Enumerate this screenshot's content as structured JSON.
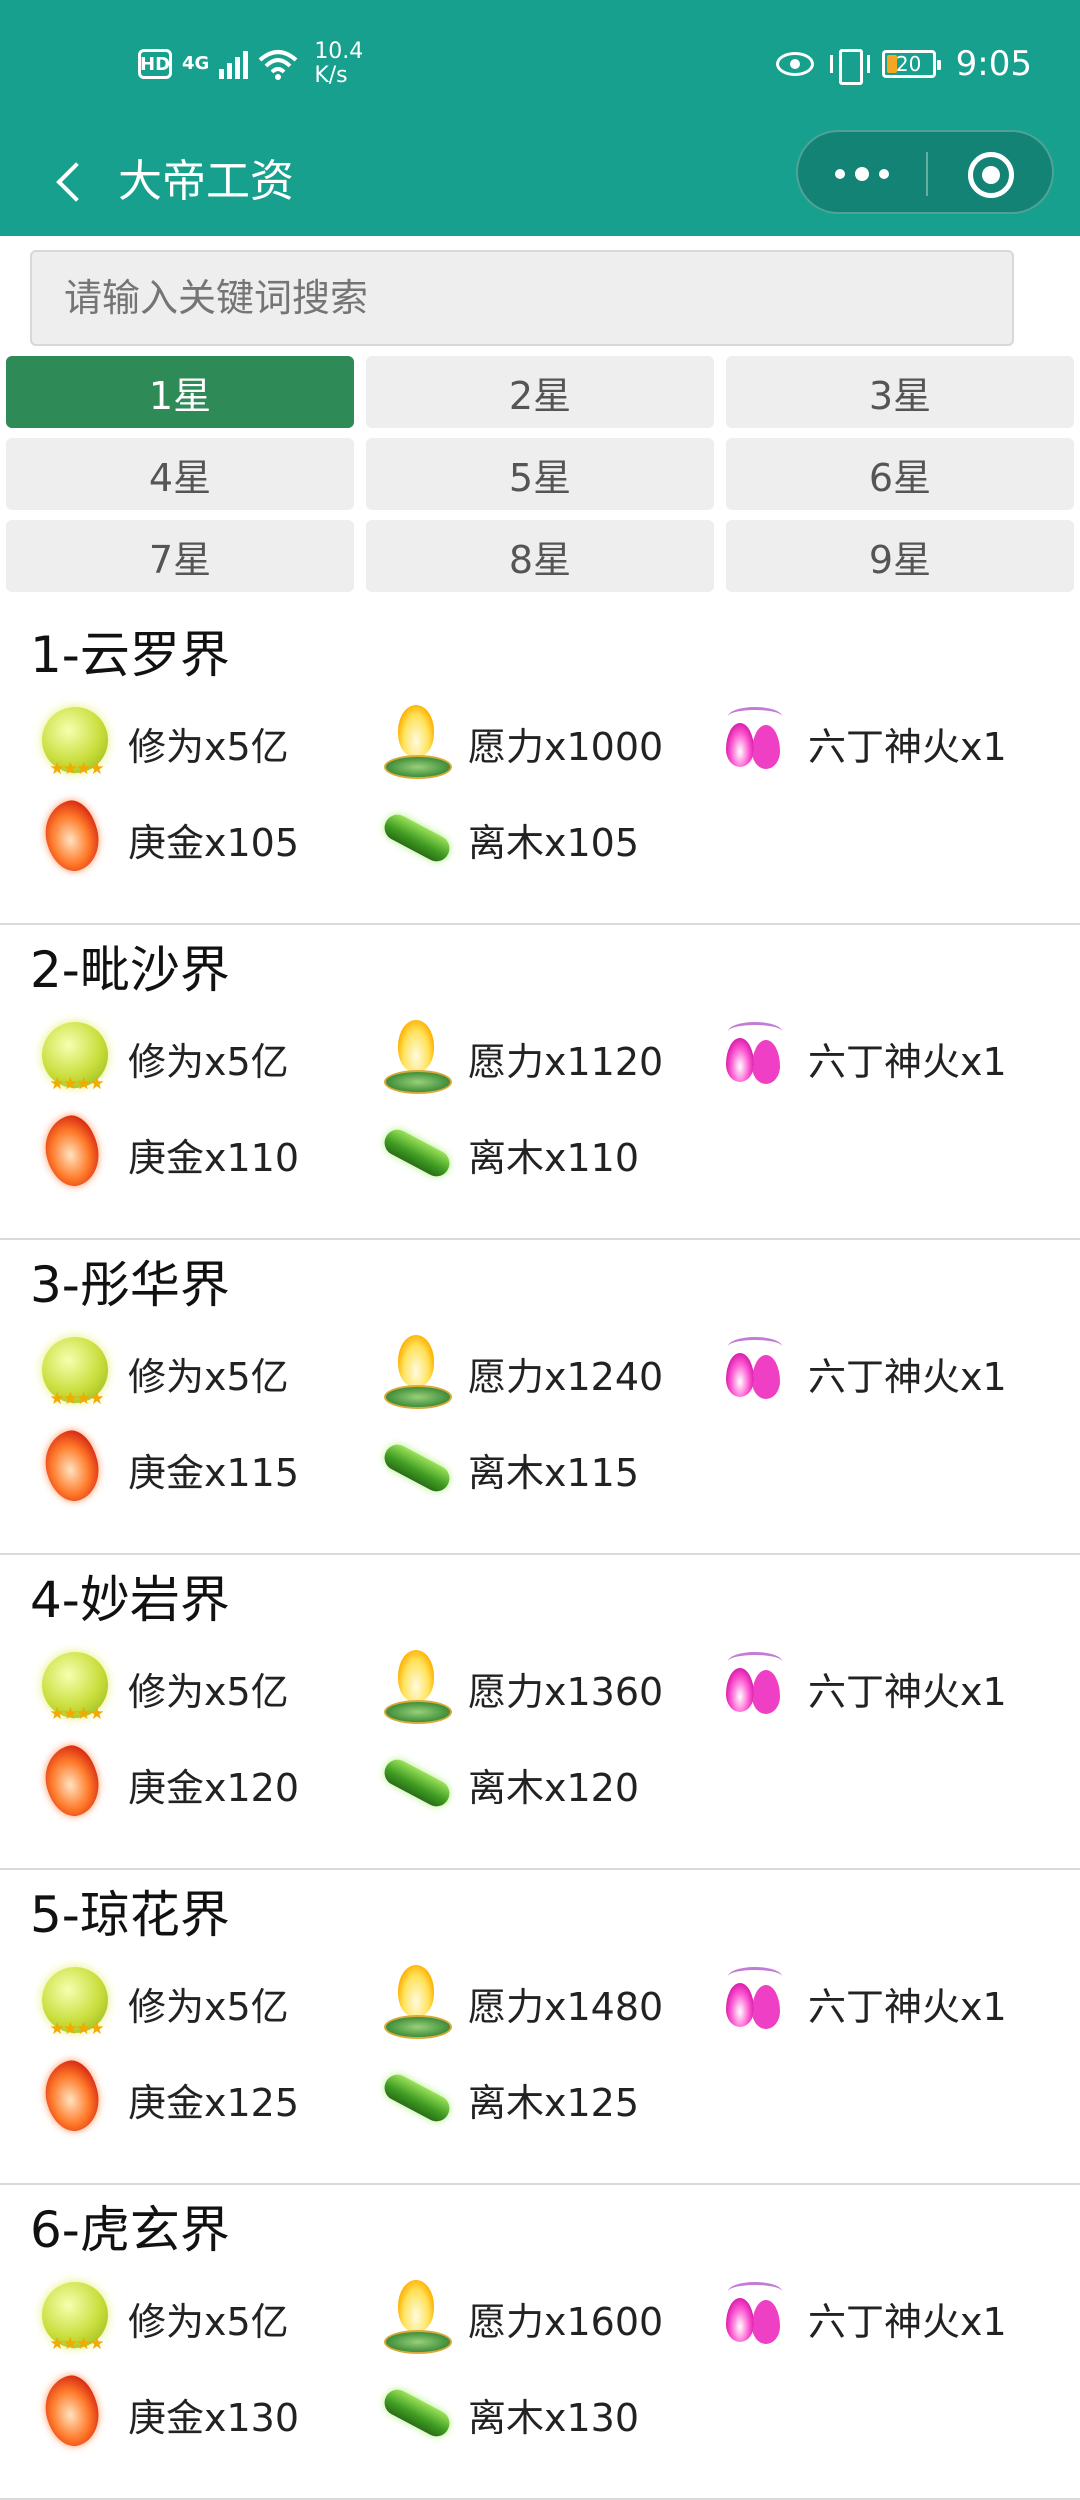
{
  "status_bar": {
    "hd": "HD",
    "network": "4G",
    "speed_value": "10.4",
    "speed_unit": "K/s",
    "battery": "20",
    "time": "9:05"
  },
  "nav": {
    "title": "大帝工资"
  },
  "search": {
    "placeholder": "请输入关键词搜索"
  },
  "star_tabs": {
    "selected": "1星",
    "items": [
      "1星",
      "2星",
      "3星",
      "4星",
      "5星",
      "6星",
      "7星",
      "8星",
      "9星"
    ]
  },
  "realms": [
    {
      "title": "1-云罗界",
      "rewards": [
        "修为x5亿",
        "愿力x1000",
        "六丁神火x1",
        "庚金x105",
        "离木x105"
      ]
    },
    {
      "title": "2-毗沙界",
      "rewards": [
        "修为x5亿",
        "愿力x1120",
        "六丁神火x1",
        "庚金x110",
        "离木x110"
      ]
    },
    {
      "title": "3-彤华界",
      "rewards": [
        "修为x5亿",
        "愿力x1240",
        "六丁神火x1",
        "庚金x115",
        "离木x115"
      ]
    },
    {
      "title": "4-妙岩界",
      "rewards": [
        "修为x5亿",
        "愿力x1360",
        "六丁神火x1",
        "庚金x120",
        "离木x120"
      ]
    },
    {
      "title": "5-琼花界",
      "rewards": [
        "修为x5亿",
        "愿力x1480",
        "六丁神火x1",
        "庚金x125",
        "离木x125"
      ]
    },
    {
      "title": "6-虎玄界",
      "rewards": [
        "修为x5亿",
        "愿力x1600",
        "六丁神火x1",
        "庚金x130",
        "离木x130"
      ]
    }
  ],
  "reward_icons": [
    "cultivation-orb-icon",
    "will-flame-icon",
    "divine-fire-icon",
    "geng-gold-icon",
    "li-wood-icon"
  ],
  "colors": {
    "header": "#17a08e",
    "active_tab": "#2e8b57",
    "tab_bg": "#eeeeee"
  }
}
